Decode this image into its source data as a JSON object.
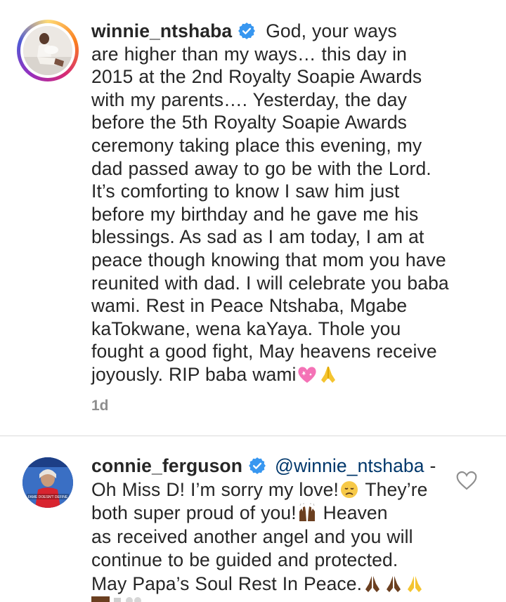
{
  "post": {
    "username": "winnie_ntshaba",
    "caption_lines": [
      "are higher than my ways… this day in",
      "2015 at the 2nd Royalty Soapie Awards",
      "with my parents…. Yesterday, the day",
      "before the 5th Royalty Soapie Awards",
      "ceremony taking place this evening, my",
      "dad passed away to go be with the Lord.",
      "It’s comforting to know I saw him just",
      "before my birthday and he gave me his",
      "blessings. As sad as I am today, I am at",
      "peace though knowing that mom you have",
      "reunited with dad. I will celebrate you baba",
      "wami. Rest in Peace Ntshaba, Mgabe",
      "kaTokwane, wena kaYaya. Thole you",
      "fought a good fight, May heavens receive"
    ],
    "caption_first": "God, your ways",
    "caption_last": "joyously. RIP baba wami",
    "caption_end_emojis": [
      "sparkling-heart-icon",
      "folded-hands-icon"
    ],
    "timestamp": "1d"
  },
  "comment": {
    "username": "connie_ferguson",
    "mention": "@winnie_ntshaba",
    "mention_suffix": " -",
    "line2_text": "Oh Miss D! I’m sorry my love!",
    "line2_tail": " They’re",
    "line3_text": "both super proud of you!",
    "line3_tail": " Heaven",
    "line4": "as received another angel and you will",
    "line5": "continue to be guided and protected.",
    "line6": "May Papa’s Soul Rest In Peace.",
    "cover_text": "FAME DOESN'T DEFINE"
  },
  "colors": {
    "text": "#262626",
    "secondary": "#8e8e8e",
    "verified": "#3897f0",
    "mention": "#00376b",
    "divider": "#dbdbdb"
  }
}
